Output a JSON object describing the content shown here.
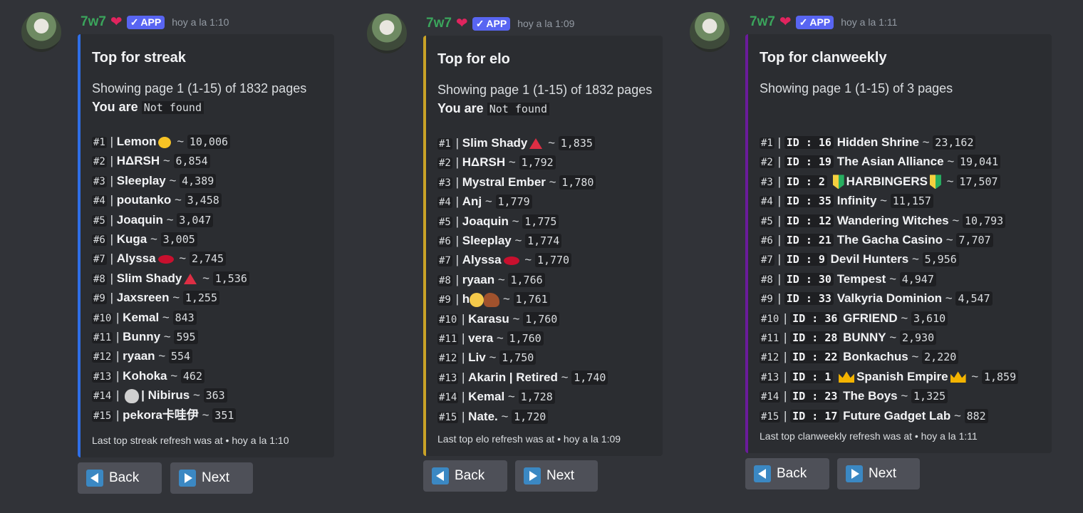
{
  "common": {
    "username": "7w7",
    "app_badge": "APP",
    "back_label": "Back",
    "next_label": "Next",
    "colors": {
      "streak_bar": "#2f6fe8",
      "elo_bar": "#c9a227",
      "clan_bar": "#6a1b9a"
    }
  },
  "messages": [
    {
      "timestamp": "hoy a la 1:10",
      "title": "Top for streak",
      "page_info": "Showing page 1 (1-15) of 1832 pages",
      "you_are_label": "You are",
      "you_are_value": "Not found",
      "footer": "Last top streak refresh was at • hoy a la 1:10",
      "rows": [
        {
          "rank": "#1",
          "name": "Lemon",
          "value": "10,006",
          "emoji": "lemon"
        },
        {
          "rank": "#2",
          "name": "HΔRSH",
          "value": "6,854"
        },
        {
          "rank": "#3",
          "name": "Sleeplay",
          "value": "4,389"
        },
        {
          "rank": "#4",
          "name": "poutanko",
          "value": "3,458"
        },
        {
          "rank": "#5",
          "name": "Joaquin",
          "value": "3,047"
        },
        {
          "rank": "#6",
          "name": "Kuga",
          "value": "3,005"
        },
        {
          "rank": "#7",
          "name": "Alyssa",
          "value": "2,745",
          "emoji": "lips"
        },
        {
          "rank": "#8",
          "name": "Slim Shady",
          "value": "1,536",
          "emoji": "triangle"
        },
        {
          "rank": "#9",
          "name": "Jaxsreen",
          "value": "1,255"
        },
        {
          "rank": "#10",
          "name": "Kemal",
          "value": "843"
        },
        {
          "rank": "#11",
          "name": "Bunny",
          "value": "595"
        },
        {
          "rank": "#12",
          "name": "ryaan",
          "value": "554"
        },
        {
          "rank": "#13",
          "name": "Kohoka",
          "value": "462"
        },
        {
          "rank": "#14",
          "name": "| Nibirus",
          "value": "363",
          "pre_emoji": "alien"
        },
        {
          "rank": "#15",
          "name": "pekora卡哇伊",
          "value": "351"
        }
      ]
    },
    {
      "timestamp": "hoy a la 1:09",
      "title": "Top for elo",
      "page_info": "Showing page 1 (1-15) of 1832 pages",
      "you_are_label": "You are",
      "you_are_value": "Not found",
      "footer": "Last top elo refresh was at • hoy a la 1:09",
      "rows": [
        {
          "rank": "#1",
          "name": "Slim Shady",
          "value": "1,835",
          "emoji": "triangle"
        },
        {
          "rank": "#2",
          "name": "HΔRSH",
          "value": "1,792"
        },
        {
          "rank": "#3",
          "name": "Mystral Ember",
          "value": "1,780"
        },
        {
          "rank": "#4",
          "name": "Anj",
          "value": "1,779"
        },
        {
          "rank": "#5",
          "name": "Joaquin",
          "value": "1,775"
        },
        {
          "rank": "#6",
          "name": "Sleeplay",
          "value": "1,774"
        },
        {
          "rank": "#7",
          "name": "Alyssa",
          "value": "1,770",
          "emoji": "lips"
        },
        {
          "rank": "#8",
          "name": "ryaan",
          "value": "1,766"
        },
        {
          "rank": "#9",
          "name": "h",
          "value": "1,761",
          "emoji": "moonhorse"
        },
        {
          "rank": "#10",
          "name": "Karasu",
          "value": "1,760"
        },
        {
          "rank": "#11",
          "name": "vera",
          "value": "1,760"
        },
        {
          "rank": "#12",
          "name": "Liv",
          "value": "1,750"
        },
        {
          "rank": "#13",
          "name": "Akarin | Retired",
          "value": "1,740"
        },
        {
          "rank": "#14",
          "name": "Kemal",
          "value": "1,728"
        },
        {
          "rank": "#15",
          "name": "Nate.",
          "value": "1,720"
        }
      ]
    },
    {
      "timestamp": "hoy a la 1:11",
      "title": "Top for clanweekly",
      "page_info": "Showing page 1 (1-15) of 3 pages",
      "footer": "Last top clanweekly refresh was at • hoy a la 1:11",
      "rows": [
        {
          "rank": "#1",
          "id": "ID : 16",
          "name": "Hidden Shrine",
          "value": "23,162"
        },
        {
          "rank": "#2",
          "id": "ID : 19",
          "name": "The Asian Alliance",
          "value": "19,041"
        },
        {
          "rank": "#3",
          "id": "ID : 2",
          "name": "HARBINGERS",
          "value": "17,507",
          "wrap": "beginner"
        },
        {
          "rank": "#4",
          "id": "ID : 35",
          "name": "Infinity",
          "value": "11,157"
        },
        {
          "rank": "#5",
          "id": "ID : 12",
          "name": "Wandering Witches",
          "value": "10,793"
        },
        {
          "rank": "#6",
          "id": "ID : 21",
          "name": "The Gacha Casino",
          "value": "7,707"
        },
        {
          "rank": "#7",
          "id": "ID : 9",
          "name": "Devil Hunters",
          "value": "5,956"
        },
        {
          "rank": "#8",
          "id": "ID : 30",
          "name": "Tempest",
          "value": "4,947"
        },
        {
          "rank": "#9",
          "id": "ID : 33",
          "name": "Valkyria Dominion",
          "value": "4,547"
        },
        {
          "rank": "#10",
          "id": "ID : 36",
          "name": "GFRIEND",
          "value": "3,610"
        },
        {
          "rank": "#11",
          "id": "ID : 28",
          "name": "BUNNY",
          "value": "2,930"
        },
        {
          "rank": "#12",
          "id": "ID : 22",
          "name": "Bonkachus",
          "value": "2,220"
        },
        {
          "rank": "#13",
          "id": "ID : 1",
          "name": "Spanish Empire",
          "value": "1,859",
          "wrap": "crown"
        },
        {
          "rank": "#14",
          "id": "ID : 23",
          "name": "The Boys",
          "value": "1,325"
        },
        {
          "rank": "#15",
          "id": "ID : 17",
          "name": "Future Gadget Lab",
          "value": "882"
        }
      ]
    }
  ]
}
